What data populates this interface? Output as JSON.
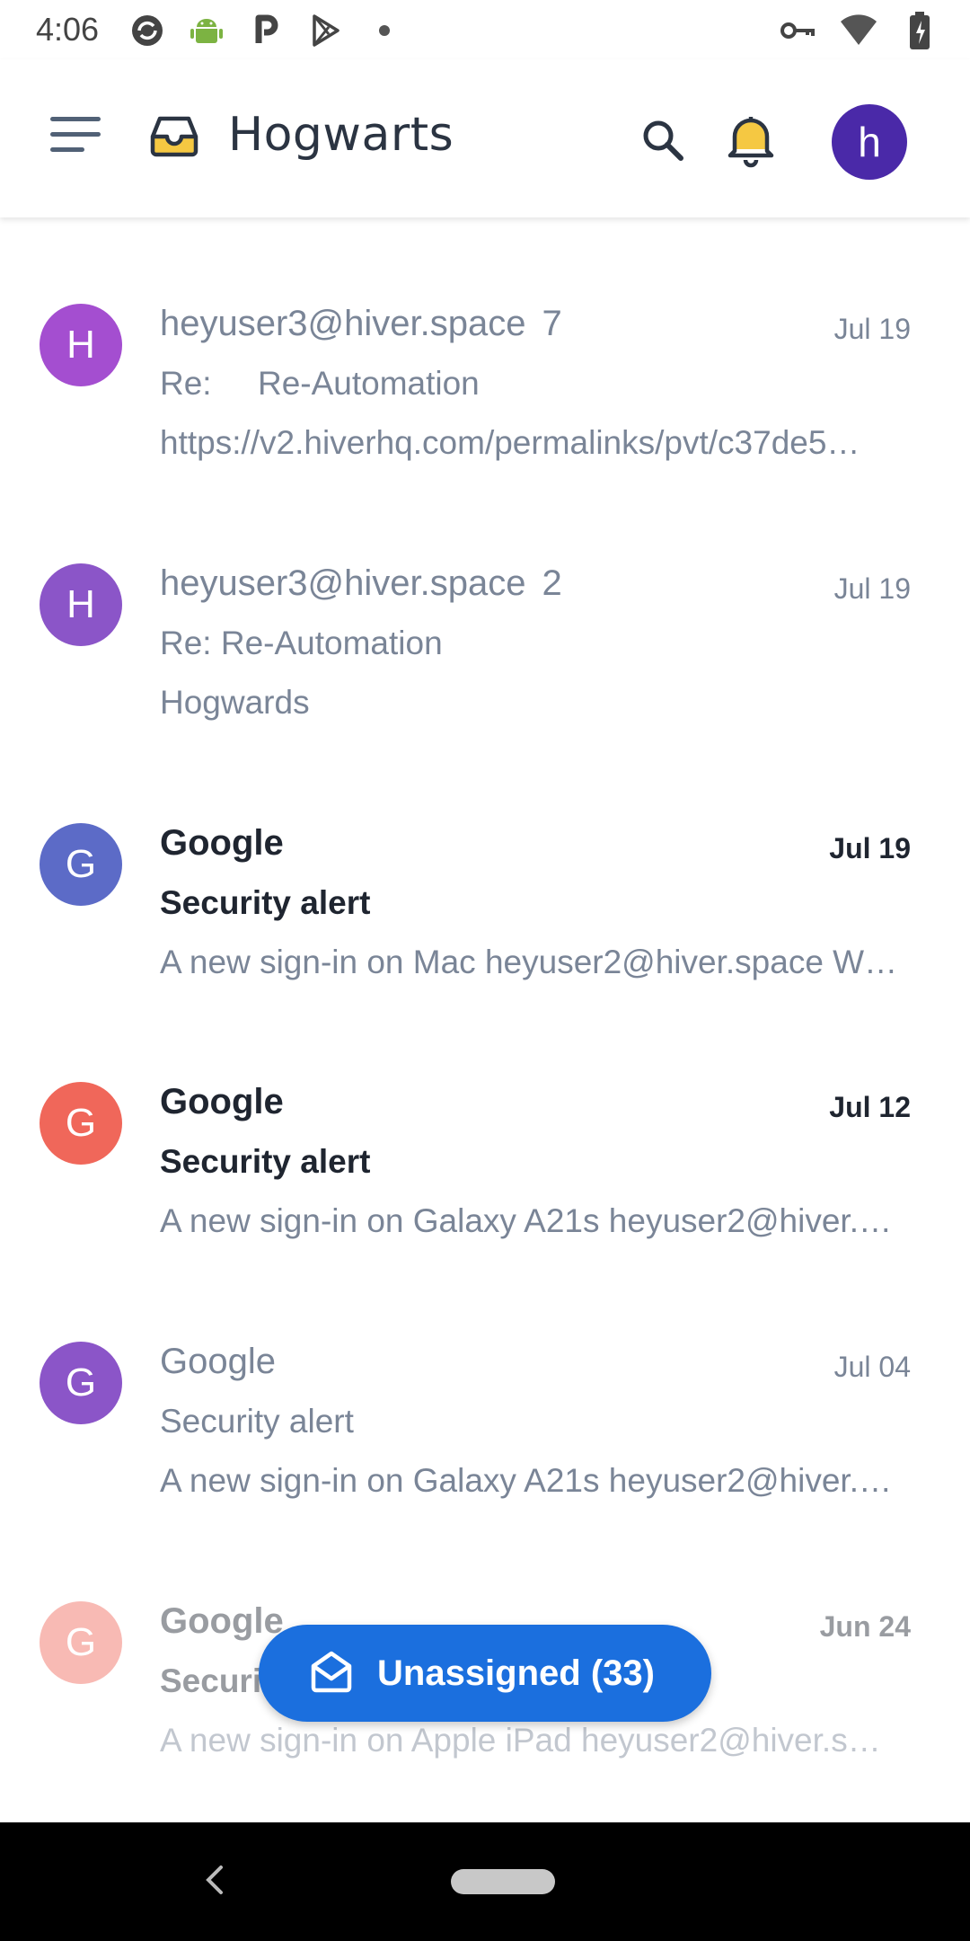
{
  "status_bar": {
    "time": "4:06",
    "left_icons": [
      "sync-icon",
      "android-icon",
      "parking-icon",
      "play-store-icon",
      "dot-icon"
    ],
    "right_icons": [
      "vpn-key-icon",
      "wifi-icon",
      "battery-icon"
    ]
  },
  "header": {
    "title": "Hogwarts",
    "avatar_letter": "h",
    "avatar_color": "#4a29a8",
    "icons": [
      "menu-icon",
      "inbox-icon",
      "search-icon",
      "bell-icon"
    ]
  },
  "conversations": [
    {
      "avatar_letter": "H",
      "avatar_color": "#a44ed0",
      "sender": "heyuser3@hiver.space",
      "count": "7",
      "date": "Jul 19",
      "subject": "Re:     Re-Automation",
      "snippet": "https://v2.hiverhq.com/permalinks/pvt/c37de5…",
      "unread": false
    },
    {
      "avatar_letter": "H",
      "avatar_color": "#8b55c8",
      "sender": "heyuser3@hiver.space",
      "count": "2",
      "date": "Jul 19",
      "subject": "Re: Re-Automation",
      "snippet": "Hogwards",
      "unread": false
    },
    {
      "avatar_letter": "G",
      "avatar_color": "#5c6bc7",
      "sender": "Google",
      "count": "",
      "date": "Jul 19",
      "subject": "Security alert",
      "snippet": "A new sign-in on Mac heyuser2@hiver.space W…",
      "unread": true
    },
    {
      "avatar_letter": "G",
      "avatar_color": "#f0675a",
      "sender": "Google",
      "count": "",
      "date": "Jul 12",
      "subject": "Security alert",
      "snippet": "A new sign-in on Galaxy A21s heyuser2@hiver.…",
      "unread": true
    },
    {
      "avatar_letter": "G",
      "avatar_color": "#8b55c8",
      "sender": "Google",
      "count": "",
      "date": "Jul 04",
      "subject": "Security alert",
      "snippet": "A new sign-in on Galaxy A21s heyuser2@hiver.…",
      "unread": false
    },
    {
      "avatar_letter": "G",
      "avatar_color": "#f0675a",
      "sender": "Google",
      "count": "",
      "date": "Jun 24",
      "subject": "Security alert",
      "snippet": "A new sign-in on Apple iPad heyuser2@hiver.s…",
      "unread": true
    }
  ],
  "fab": {
    "label": "Unassigned (33)",
    "icon": "envelope-open-icon",
    "color": "#1b6fde"
  },
  "nav_bar": {
    "icons": [
      "back-icon",
      "home-pill-icon"
    ]
  }
}
